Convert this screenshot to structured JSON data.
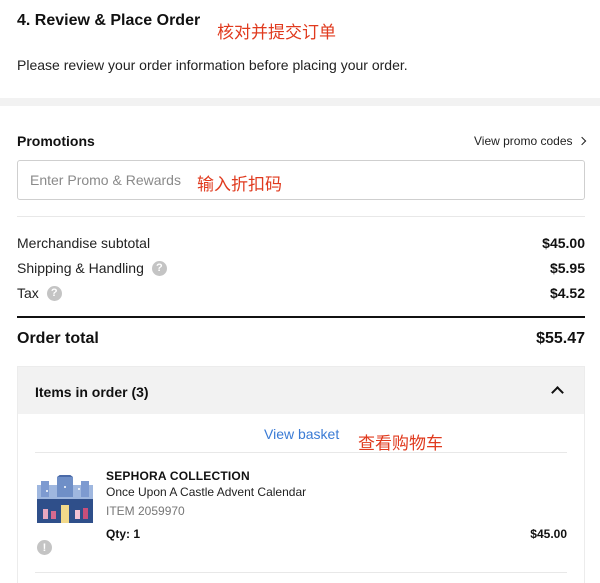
{
  "review": {
    "title": "4. Review & Place Order",
    "note": "核对并提交订单",
    "description": "Please review your order information before placing your order."
  },
  "promotions": {
    "label": "Promotions",
    "view_codes_label": "View promo codes",
    "placeholder": "Enter Promo & Rewards",
    "note": "输入折扣码"
  },
  "summary": {
    "rows": [
      {
        "label": "Merchandise subtotal",
        "value": "$45.00",
        "help": false
      },
      {
        "label": "Shipping & Handling",
        "value": "$5.95",
        "help": true
      },
      {
        "label": "Tax",
        "value": "$4.52",
        "help": true
      }
    ],
    "help_glyph": "?",
    "total_label": "Order total",
    "total_value": "$55.47"
  },
  "items": {
    "title": "Items in order (3)",
    "view_basket_label": "View basket",
    "basket_note": "查看购物车",
    "product": {
      "brand": "SEPHORA COLLECTION",
      "name": "Once Upon A Castle Advent Calendar",
      "sku": "ITEM 2059970",
      "qty": "Qty: 1",
      "price": "$45.00",
      "alert_glyph": "!"
    }
  },
  "colors": {
    "annotation_red": "#e03a1e",
    "link_blue": "#3a7bd5",
    "band_gray": "#f2f2f2"
  },
  "icons": [
    "chevron-right-icon",
    "help-icon",
    "chevron-up-icon",
    "alert-icon"
  ]
}
